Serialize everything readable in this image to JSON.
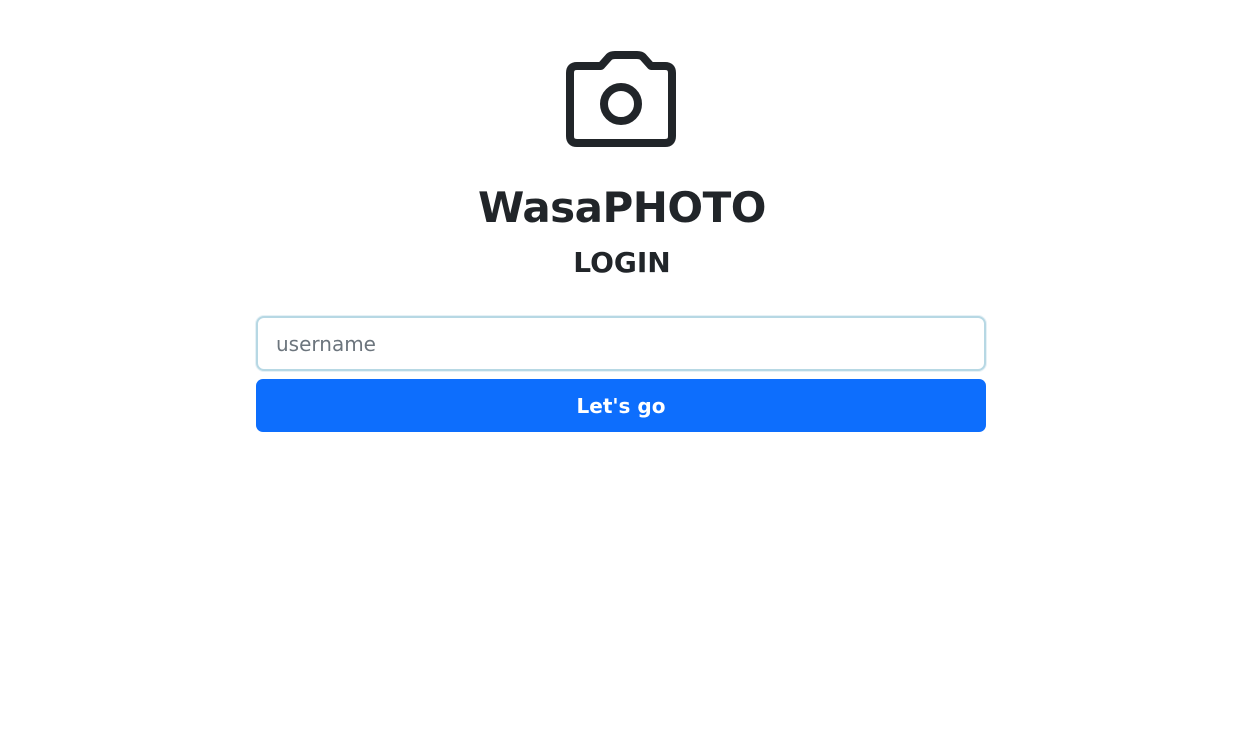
{
  "header": {
    "logo_icon": "camera-icon",
    "app_title": "WasaPHOTO",
    "subtitle": "LOGIN"
  },
  "login_form": {
    "username_placeholder": "username",
    "username_value": "",
    "submit_label": "Let's go"
  },
  "colors": {
    "primary": "#0d6efd",
    "text": "#212529",
    "input_border": "#b7d8e4",
    "placeholder": "#6c757d"
  }
}
